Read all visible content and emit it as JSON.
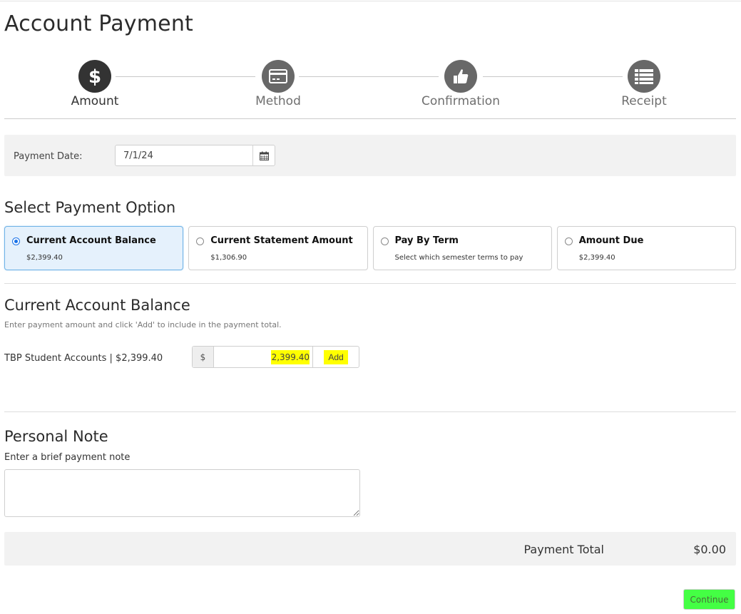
{
  "page": {
    "title": "Account Payment"
  },
  "stepper": {
    "steps": [
      {
        "label": "Amount",
        "icon": "dollar-icon",
        "active": true
      },
      {
        "label": "Method",
        "icon": "credit-card-icon",
        "active": false
      },
      {
        "label": "Confirmation",
        "icon": "thumbs-up-icon",
        "active": false
      },
      {
        "label": "Receipt",
        "icon": "list-icon",
        "active": false
      }
    ]
  },
  "payment_date": {
    "label": "Payment Date:",
    "value": "7/1/24",
    "icon": "calendar-icon"
  },
  "payment_option": {
    "heading": "Select Payment Option",
    "options": [
      {
        "title": "Current Account Balance",
        "subtitle": "$2,399.40",
        "selected": true
      },
      {
        "title": "Current Statement Amount",
        "subtitle": "$1,306.90",
        "selected": false
      },
      {
        "title": "Pay By Term",
        "subtitle": "Select which semester terms to pay",
        "selected": false
      },
      {
        "title": "Amount Due",
        "subtitle": "$2,399.40",
        "selected": false
      }
    ]
  },
  "balance_section": {
    "heading": "Current Account Balance",
    "hint": "Enter payment amount and click 'Add' to include in the payment total.",
    "account_label": "TBP Student Accounts | $2,399.40",
    "currency_symbol": "$",
    "amount_value": "2,399.40",
    "add_label": "Add",
    "highlight_color": "#ffff00"
  },
  "personal_note": {
    "heading": "Personal Note",
    "label": "Enter a brief payment note",
    "value": ""
  },
  "total": {
    "label": "Payment Total",
    "value": "$0.00"
  },
  "actions": {
    "continue_label": "Continue",
    "continue_highlight": "#44ff44"
  }
}
